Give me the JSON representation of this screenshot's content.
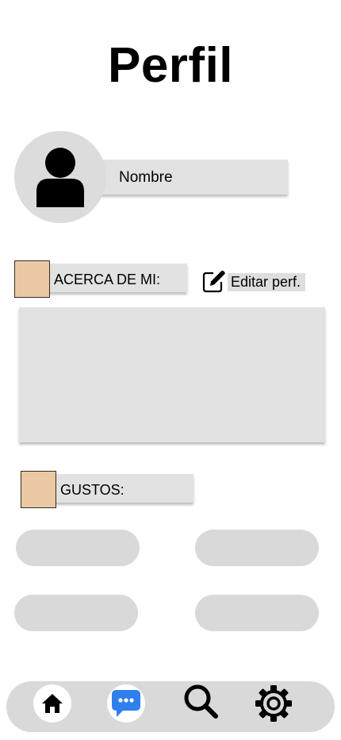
{
  "header": {
    "title": "Perfil"
  },
  "profile": {
    "name_label": "Nombre"
  },
  "about": {
    "label": "ACERCA DE MI:",
    "edit_label": "Editar perf.",
    "text": ""
  },
  "likes": {
    "label": "GUSTOS:",
    "tags": [
      "",
      "",
      "",
      ""
    ]
  },
  "nav": {
    "items": [
      {
        "id": "home",
        "icon": "home-icon",
        "active": true
      },
      {
        "id": "messages",
        "icon": "chat-icon"
      },
      {
        "id": "search",
        "icon": "search-icon"
      },
      {
        "id": "settings",
        "icon": "gear-icon"
      }
    ]
  },
  "colors": {
    "swatch": "#ebc9a5",
    "field": "#e2e2e2",
    "pill": "#d9d9d9",
    "chat_blue": "#2f80ed"
  }
}
